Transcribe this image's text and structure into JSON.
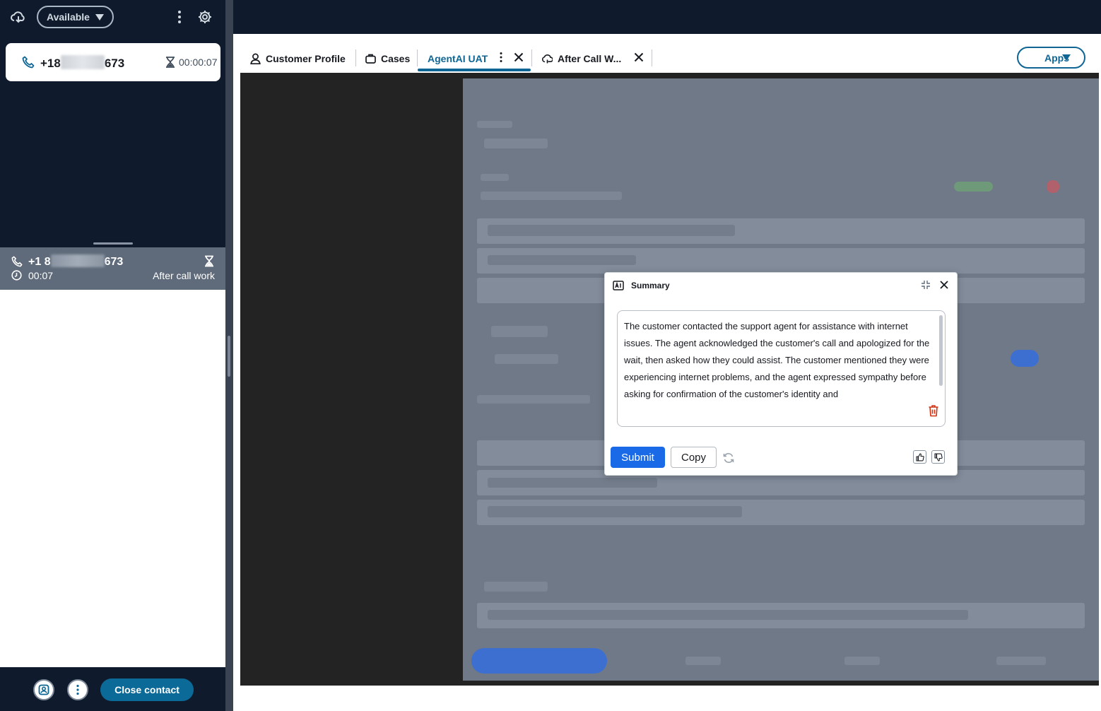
{
  "agent_panel": {
    "status_label": "Available",
    "active_contact": {
      "number_prefix": "+18",
      "number_suffix": "673",
      "timer": "00:00:07"
    },
    "acw_contact": {
      "number_prefix": "+1 8",
      "number_suffix": "673",
      "elapsed": "00:07",
      "state_label": "After call work"
    },
    "close_contact_label": "Close contact"
  },
  "tabs": [
    {
      "label": "Customer Profile",
      "icon": "user-icon"
    },
    {
      "label": "Cases",
      "icon": "briefcase-icon"
    },
    {
      "label": "AgentAI UAT",
      "icon": "",
      "active": true
    },
    {
      "label": "After Call W...",
      "icon": "cloud-chat-icon"
    }
  ],
  "apps_label": "Apps",
  "summary_dialog": {
    "title": "Summary",
    "text": "The customer contacted the support agent for assistance with internet issues. The agent acknowledged the customer's call and apologized for the wait, then asked how they could assist. The customer mentioned they were experiencing internet problems, and the agent expressed sympathy before asking for confirmation of the customer's identity and",
    "submit_label": "Submit",
    "copy_label": "Copy"
  },
  "colors": {
    "nav_dark": "#0f1b2d",
    "accent_teal": "#0f6694",
    "submit_blue": "#1a6ae8",
    "acw_row": "#5f6b7a"
  }
}
